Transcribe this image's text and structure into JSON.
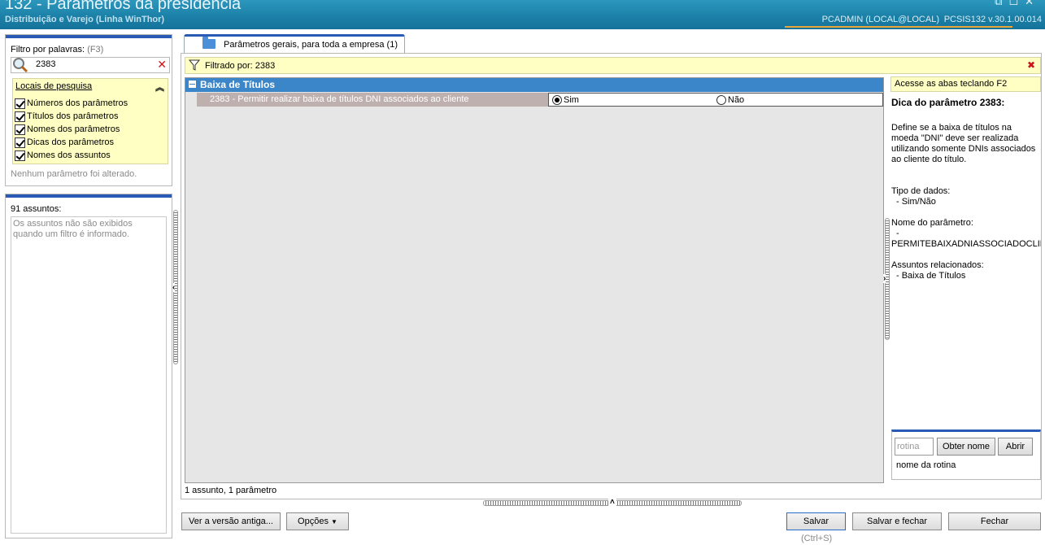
{
  "window": {
    "title": "132 - Parâmetros da presidência",
    "subtitle": "Distribuição e Varejo (Linha WinThor)",
    "user": "PCADMIN (LOCAL@LOCAL)",
    "version": "PCSIS132  v.30.1.00.014"
  },
  "filter": {
    "label": "Filtro por palavras:",
    "shortcut": "(F3)",
    "value": "2383",
    "locais_header": "Locais de pesquisa",
    "locais": [
      {
        "label": "Números dos parâmetros",
        "checked": true
      },
      {
        "label": "Títulos dos parâmetros",
        "checked": true
      },
      {
        "label": "Nomes dos parâmetros",
        "checked": true
      },
      {
        "label": "Dicas dos parâmetros",
        "checked": true
      },
      {
        "label": "Nomes dos assuntos",
        "checked": true
      }
    ],
    "status": "Nenhum parâmetro foi alterado."
  },
  "assuntos": {
    "count_label": "91 assuntos:",
    "note": "Os assuntos não são exibidos quando um filtro é informado."
  },
  "tab": {
    "label": "Parâmetros gerais, para toda a empresa  (1)"
  },
  "filter_bar": {
    "text": "Filtrado por: 2383"
  },
  "grid": {
    "group": "Baixa de Títulos",
    "param": {
      "label": "2383 - Permitir realizar baixa de títulos DNI associados ao cliente",
      "options": [
        "Sim",
        "Não"
      ],
      "selected": "Sim"
    },
    "status": "1 assunto, 1 parâmetro"
  },
  "info": {
    "hint": "Acesse as abas teclando F2",
    "title": "Dica do parâmetro 2383:",
    "description": "Define se a baixa de títulos na moeda \"DNI\" deve ser realizada utilizando somente DNIs associados ao cliente do título.",
    "tipo_label": "Tipo de dados:",
    "tipo_value": "- Sim/Não",
    "nome_label": "Nome do parâmetro:",
    "nome_dash": "-",
    "nome_value": "PERMITEBAIXADNIASSOCIADOCLIENTE",
    "assuntos_label": "Assuntos relacionados:",
    "assuntos_value": "- Baixa de Títulos"
  },
  "rotina": {
    "placeholder": "rotina",
    "obter": "Obter nome",
    "abrir": "Abrir",
    "name_label": "nome da rotina"
  },
  "buttons": {
    "ver_antiga": "Ver a versão antiga...",
    "opcoes": "Opções",
    "salvar": "Salvar",
    "salvar_shortcut": "(Ctrl+S)",
    "salvar_fechar": "Salvar e fechar",
    "fechar": "Fechar"
  },
  "colors": {
    "titlebar": "#1b7fa6",
    "accent_blue": "#2a5bb4",
    "group_header": "#3a86c8",
    "hint_yellow": "#ffffc4",
    "close_red": "#c8161d"
  }
}
